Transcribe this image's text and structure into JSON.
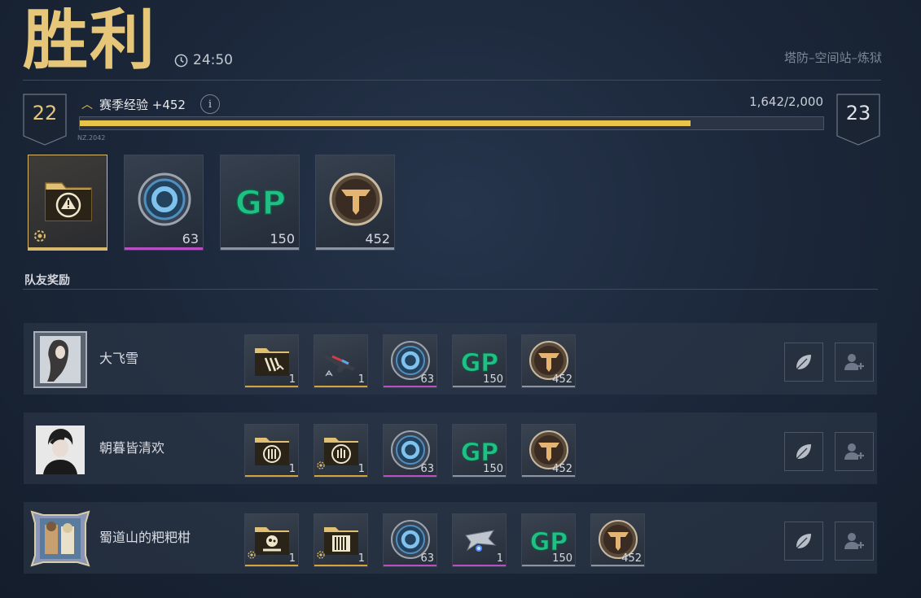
{
  "header": {
    "title": "胜利",
    "duration": "24:50",
    "mode": "塔防–空间站–炼狱"
  },
  "season": {
    "current_level": "22",
    "next_level": "23",
    "label": "赛季经验 +452",
    "info_icon_text": "i",
    "progress_text": "1,642/2,000",
    "progress_fraction": 0.821,
    "tag": "NZ.2042"
  },
  "rewards": [
    {
      "icon": "reward-crate-icon",
      "count": "",
      "rarity_color": "#d8b96e"
    },
    {
      "icon": "blue-medal-icon",
      "count": "63",
      "rarity_color": "#b84fc4"
    },
    {
      "icon": "gp-icon",
      "count": "150",
      "rarity_color": "#8a94a3"
    },
    {
      "icon": "gold-emblem-icon",
      "count": "452",
      "rarity_color": "#8a94a3"
    }
  ],
  "teammates": {
    "section_title": "队友奖励",
    "players": [
      {
        "name": "大飞雪",
        "items": [
          {
            "icon": "crate-icon",
            "count": "1",
            "rarity_color": "#d8a23a"
          },
          {
            "icon": "rifle-icon",
            "count": "1",
            "rarity_color": "#d8a23a"
          },
          {
            "icon": "blue-medal-icon",
            "count": "63",
            "rarity_color": "#b84fc4"
          },
          {
            "icon": "gp-icon",
            "count": "150",
            "rarity_color": "#8a94a3"
          },
          {
            "icon": "gold-emblem-icon",
            "count": "452",
            "rarity_color": "#8a94a3"
          }
        ]
      },
      {
        "name": "朝暮皆清欢",
        "items": [
          {
            "icon": "crate-icon",
            "count": "1",
            "rarity_color": "#d8a23a"
          },
          {
            "icon": "crate-icon",
            "count": "1",
            "rarity_color": "#d8a23a"
          },
          {
            "icon": "blue-medal-icon",
            "count": "63",
            "rarity_color": "#b84fc4"
          },
          {
            "icon": "gp-icon",
            "count": "150",
            "rarity_color": "#8a94a3"
          },
          {
            "icon": "gold-emblem-icon",
            "count": "452",
            "rarity_color": "#8a94a3"
          }
        ]
      },
      {
        "name": "蜀道山的粑粑柑",
        "items": [
          {
            "icon": "crate-icon",
            "count": "1",
            "rarity_color": "#d8a23a"
          },
          {
            "icon": "crate-icon",
            "count": "1",
            "rarity_color": "#d8a23a"
          },
          {
            "icon": "blue-medal-icon",
            "count": "63",
            "rarity_color": "#b84fc4"
          },
          {
            "icon": "drone-icon",
            "count": "1",
            "rarity_color": "#b84fc4"
          },
          {
            "icon": "gp-icon",
            "count": "150",
            "rarity_color": "#8a94a3"
          },
          {
            "icon": "gold-emblem-icon",
            "count": "452",
            "rarity_color": "#8a94a3"
          }
        ]
      }
    ]
  },
  "colors": {
    "accent_gold": "#e6c77a",
    "progress_fill": "#e8c44a"
  }
}
